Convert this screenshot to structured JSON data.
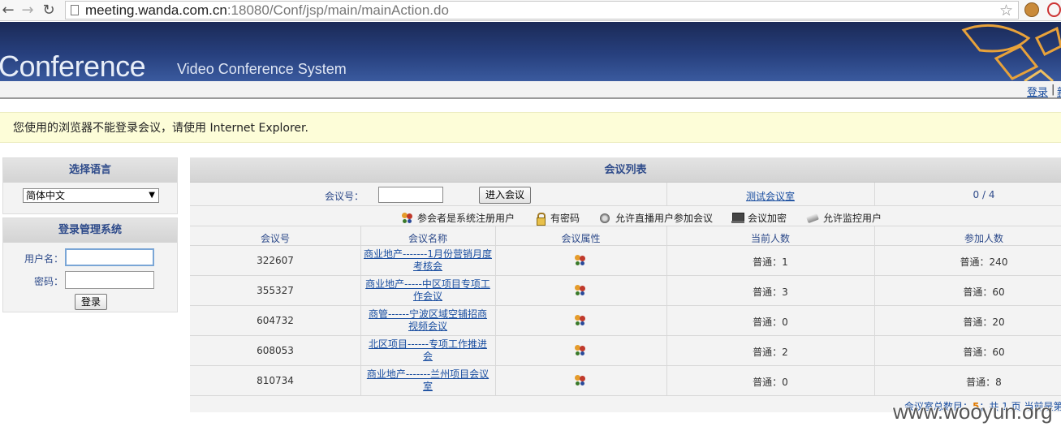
{
  "browser": {
    "url_host": "meeting.wanda.com.cn",
    "url_rest": ":18080/Conf/jsp/main/mainAction.do"
  },
  "banner": {
    "logo": "Conference",
    "subtitle": "Video Conference System"
  },
  "toolbar": {
    "login_link": "登录",
    "separator": "|",
    "next_link_partial": "新"
  },
  "warning": "您使用的浏览器不能登录会议，请使用 Internet Explorer.",
  "language_panel": {
    "title": "选择语言",
    "selected": "简体中文"
  },
  "login_panel": {
    "title": "登录管理系统",
    "username_label": "用户名：",
    "password_label": "密码：",
    "login_button": "登录"
  },
  "meeting_list": {
    "title": "会议列表",
    "meeting_no_label": "会议号：",
    "enter_button": "进入会议",
    "test_room_link": "测试会议室",
    "test_room_count": "0 / 4",
    "legend": [
      {
        "icon": "users-icon",
        "label": "参会者是系统注册用户"
      },
      {
        "icon": "lock-icon",
        "label": "有密码"
      },
      {
        "icon": "broadcast-icon",
        "label": "允许直播用户参加会议"
      },
      {
        "icon": "encrypt-icon",
        "label": "会议加密"
      },
      {
        "icon": "monitor-icon",
        "label": "允许监控用户"
      }
    ],
    "columns": [
      "会议号",
      "会议名称",
      "会议属性",
      "当前人数",
      "参加人数"
    ],
    "rows": [
      {
        "id": "322607",
        "name_line1": "商业地产-------1月份营销月度",
        "name_line2": "考核会",
        "current": "普通：1",
        "total": "普通：240"
      },
      {
        "id": "355327",
        "name_line1": "商业地产-----中区项目专项工",
        "name_line2": "作会议",
        "current": "普通：3",
        "total": "普通：60"
      },
      {
        "id": "604732",
        "name_line1": "商管------宁波区域空铺招商",
        "name_line2": "视频会议",
        "current": "普通：0",
        "total": "普通：20"
      },
      {
        "id": "608053",
        "name_line1": "北区项目------专项工作推进",
        "name_line2": "会",
        "current": "普通：2",
        "total": "普通：60"
      },
      {
        "id": "810734",
        "name_line1": "商业地产-------兰州项目会议",
        "name_line2": "室",
        "current": "普通：0",
        "total": "普通：8"
      }
    ],
    "footer": {
      "label": "会议室总数目：",
      "count": "5",
      "pages": "；共 1 页 当前是第"
    }
  },
  "watermark": "www.wooyun.org"
}
